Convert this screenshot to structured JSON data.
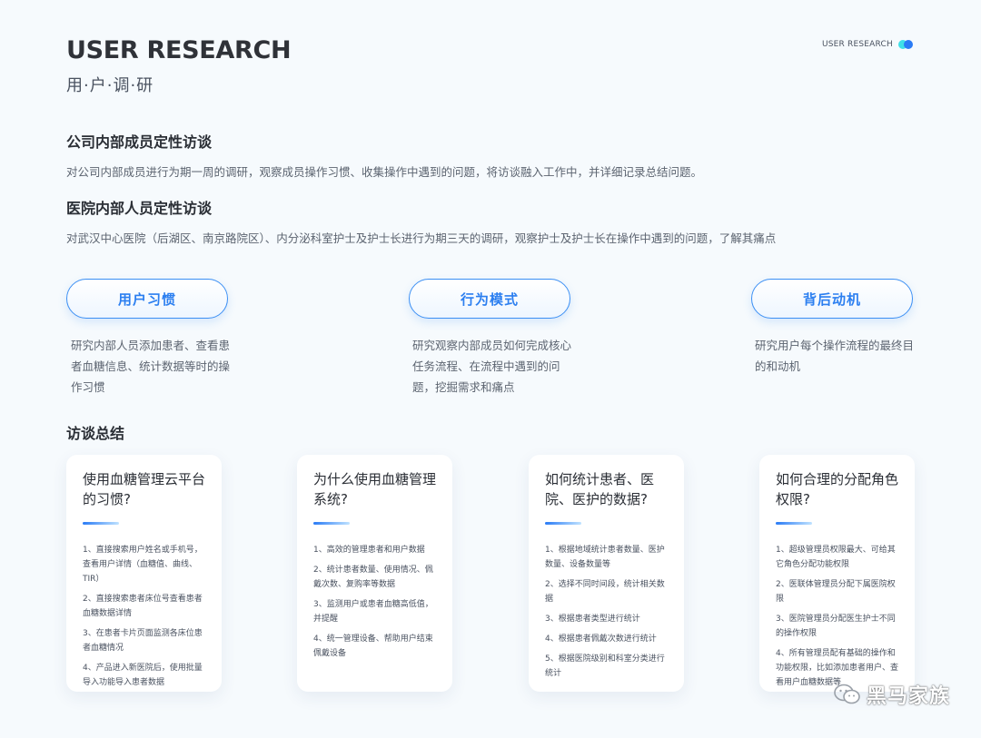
{
  "header": {
    "title_en": "USER RESEARCH",
    "title_cn": "用·户·调·研",
    "tag": "USER RESEARCH"
  },
  "sections": [
    {
      "heading": "公司内部成员定性访谈",
      "text": "对公司内部成员进行为期一周的调研，观察成员操作习惯、收集操作中遇到的问题，将访谈融入工作中，并详细记录总结问题。"
    },
    {
      "heading": "医院内部人员定性访谈",
      "text": "对武汉中心医院（后湖区、南京路院区）、内分泌科室护士及护士长进行为期三天的调研，观察护士及护士长在操作中遇到的问题，了解其痛点"
    }
  ],
  "pills": [
    {
      "label": "用户习惯",
      "desc": "研究内部人员添加患者、查看患者血糖信息、统计数据等时的操作习惯"
    },
    {
      "label": "行为模式",
      "desc": "研究观察内部成员如何完成核心任务流程、在流程中遇到的问题，挖掘需求和痛点"
    },
    {
      "label": "背后动机",
      "desc": "研究用户每个操作流程的最终目的和动机"
    }
  ],
  "summary": {
    "heading": "访谈总结",
    "cards": [
      {
        "title": "使用血糖管理云平台的习惯?",
        "items": [
          "1、直接搜索用户姓名或手机号，查看用户详情（血糖值、曲线、TIR）",
          "2、直接搜索患者床位号查看患者血糖数据详情",
          "3、在患者卡片页面监测各床位患者血糖情况",
          "4、产品进入新医院后，使用批量导入功能导入患者数据"
        ]
      },
      {
        "title": "为什么使用血糖管理系统?",
        "items": [
          "1、高效的管理患者和用户数据",
          "2、统计患者数量、使用情况、佩戴次数、复购率等数据",
          "3、监测用户或患者血糖高低值，并提醒",
          "4、统一管理设备、帮助用户结束佩戴设备"
        ]
      },
      {
        "title": "如何统计患者、医院、医护的数据?",
        "items": [
          "1、根据地域统计患者数量、医护数量、设备数量等",
          "2、选择不同时间段，统计相关数据",
          "3、根据患者类型进行统计",
          "4、根据患者佩戴次数进行统计",
          "5、根据医院级别和科室分类进行统计"
        ]
      },
      {
        "title": "如何合理的分配角色权限?",
        "items": [
          "1、超级管理员权限最大、可给其它角色分配功能权限",
          "2、医联体管理员分配下属医院权限",
          "3、医院管理员分配医生护士不同的操作权限",
          "4、所有管理员配有基础的操作和功能权限，比如添加患者用户、查看用户血糖数据等"
        ]
      }
    ]
  },
  "watermark": {
    "text": "黑马家族",
    "icon": "wechat-icon"
  }
}
